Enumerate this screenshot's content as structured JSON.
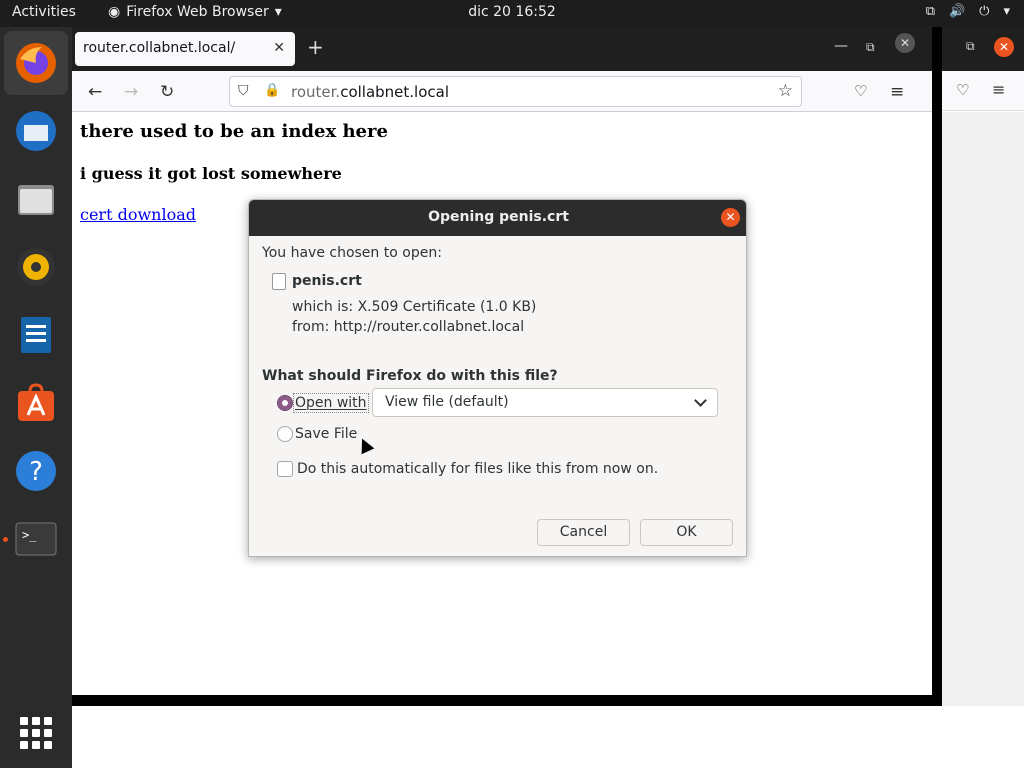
{
  "topbar": {
    "activities": "Activities",
    "app_name": "Firefox Web Browser",
    "clock": "dic 20  16:52"
  },
  "browser": {
    "tab_title": "router.collabnet.local/",
    "url_domain_prefix": "router.",
    "url_domain_main": "collabnet.local"
  },
  "page": {
    "heading": "there used to be an index here",
    "subheading": "i guess it got lost somewhere",
    "link": "cert download"
  },
  "dialog": {
    "title": "Opening penis.crt",
    "chosen_label": "You have chosen to open:",
    "filename": "penis.crt",
    "which_is": "which is:  X.509 Certificate (1.0 KB)",
    "from": "from:  http://router.collabnet.local",
    "question": "What should Firefox do with this file?",
    "open_with_label": "Open with",
    "open_with_value": "View file (default)",
    "save_label": "Save File",
    "auto_label": "Do this automatically for files like this from now on.",
    "cancel": "Cancel",
    "ok": "OK"
  },
  "colors": {
    "accent": "#e95420",
    "radio_selected": "#8f5b8a"
  }
}
